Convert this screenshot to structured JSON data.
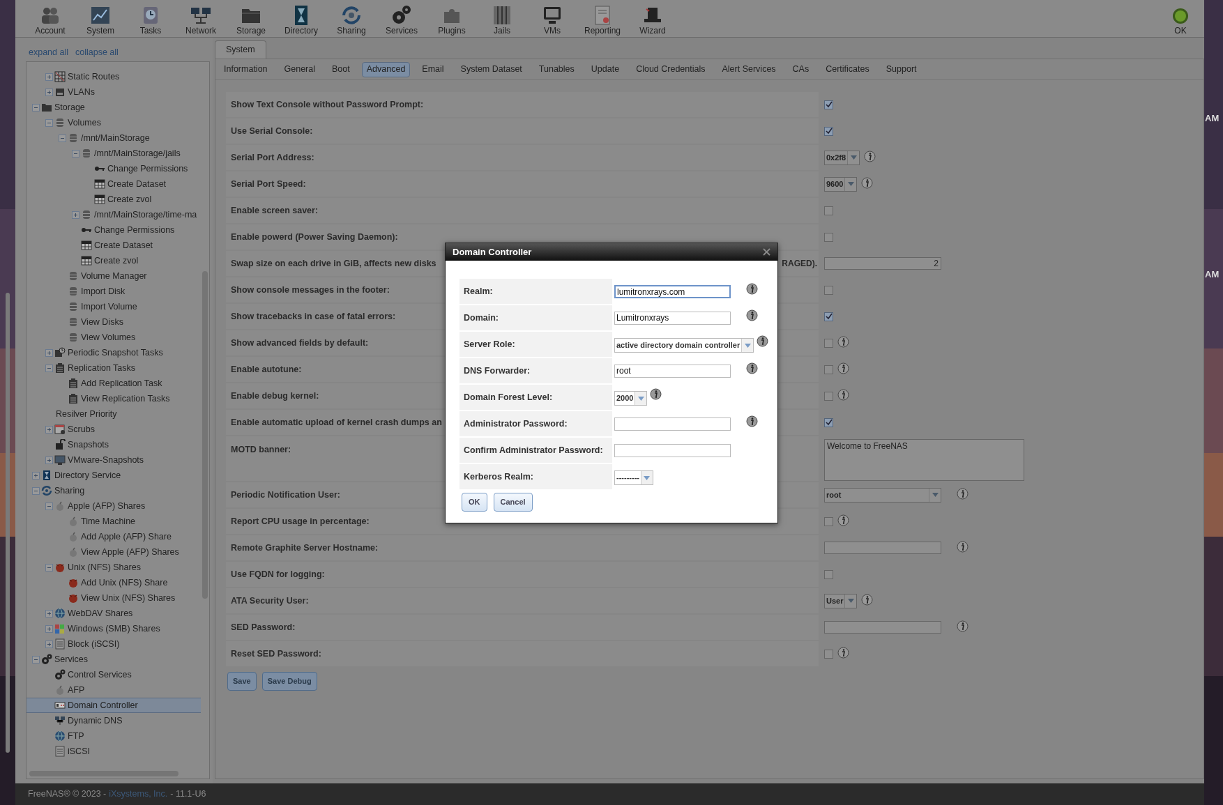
{
  "desktop": {
    "clock_fragments": [
      "AM",
      "AM"
    ]
  },
  "toolbar": {
    "items": [
      {
        "label": "Account"
      },
      {
        "label": "System"
      },
      {
        "label": "Tasks"
      },
      {
        "label": "Network"
      },
      {
        "label": "Storage"
      },
      {
        "label": "Directory"
      },
      {
        "label": "Sharing"
      },
      {
        "label": "Services"
      },
      {
        "label": "Plugins"
      },
      {
        "label": "Jails"
      },
      {
        "label": "VMs"
      },
      {
        "label": "Reporting"
      },
      {
        "label": "Wizard"
      }
    ],
    "alert": {
      "label": "OK"
    }
  },
  "sidebar": {
    "links": [
      "expand all",
      "collapse all"
    ],
    "tree": [
      {
        "children": [
          {
            "label": "Static Routes",
            "expanded": false,
            "selected": false
          },
          {
            "label": "VLANs",
            "expanded": false,
            "selected": false
          }
        ]
      },
      {
        "label": "Storage",
        "expanded": true,
        "selected": false,
        "children": [
          {
            "label": "Volumes",
            "expanded": true,
            "selected": false,
            "children": [
              {
                "label": "/mnt/MainStorage",
                "expanded": true,
                "selected": false,
                "children": [
                  {
                    "label": "/mnt/MainStorage/jails",
                    "expanded": true,
                    "selected": false,
                    "children": [
                      {
                        "label": "Change Permissions",
                        "selected": false
                      },
                      {
                        "label": "Create Dataset",
                        "selected": false
                      },
                      {
                        "label": "Create zvol",
                        "selected": false
                      }
                    ]
                  },
                  {
                    "label": "/mnt/MainStorage/time-ma",
                    "expanded": false,
                    "selected": false
                  },
                  {
                    "label": "Change Permissions",
                    "selected": false
                  },
                  {
                    "label": "Create Dataset",
                    "selected": false
                  },
                  {
                    "label": "Create zvol",
                    "selected": false
                  }
                ]
              },
              {
                "label": "Volume Manager",
                "selected": false
              },
              {
                "label": "Import Disk",
                "selected": false
              },
              {
                "label": "Import Volume",
                "selected": false
              },
              {
                "label": "View Disks",
                "selected": false
              },
              {
                "label": "View Volumes",
                "selected": false
              }
            ]
          },
          {
            "label": "Periodic Snapshot Tasks",
            "expanded": false,
            "selected": false
          },
          {
            "label": "Replication Tasks",
            "expanded": true,
            "selected": false,
            "children": [
              {
                "label": "Add Replication Task",
                "selected": false
              },
              {
                "label": "View Replication Tasks",
                "selected": false
              }
            ]
          },
          {
            "label": "Resilver Priority",
            "selected": false
          },
          {
            "label": "Scrubs",
            "expanded": false,
            "selected": false
          },
          {
            "label": "Snapshots",
            "selected": false
          },
          {
            "label": "VMware-Snapshots",
            "expanded": false,
            "selected": false
          }
        ]
      },
      {
        "label": "Directory Service",
        "expanded": false,
        "selected": false
      },
      {
        "label": "Sharing",
        "expanded": true,
        "selected": false,
        "children": [
          {
            "label": "Apple (AFP) Shares",
            "expanded": true,
            "selected": false,
            "children": [
              {
                "label": "Time Machine",
                "selected": false
              },
              {
                "label": "Add Apple (AFP) Share",
                "selected": false
              },
              {
                "label": "View Apple (AFP) Shares",
                "selected": false
              }
            ]
          },
          {
            "label": "Unix (NFS) Shares",
            "expanded": true,
            "selected": false,
            "children": [
              {
                "label": "Add Unix (NFS) Share",
                "selected": false
              },
              {
                "label": "View Unix (NFS) Shares",
                "selected": false
              }
            ]
          },
          {
            "label": "WebDAV Shares",
            "expanded": false,
            "selected": false
          },
          {
            "label": "Windows (SMB) Shares",
            "expanded": false,
            "selected": false
          },
          {
            "label": "Block (iSCSI)",
            "expanded": false,
            "selected": false
          }
        ]
      },
      {
        "label": "Services",
        "expanded": true,
        "selected": false,
        "children": [
          {
            "label": "Control Services",
            "selected": false
          },
          {
            "label": "AFP",
            "selected": false
          },
          {
            "label": "Domain Controller",
            "selected": true
          },
          {
            "label": "Dynamic DNS",
            "selected": false
          },
          {
            "label": "FTP",
            "selected": false
          },
          {
            "label": "iSCSI",
            "selected": false
          }
        ]
      }
    ]
  },
  "main": {
    "tabs": [
      {
        "label": "System",
        "selected": true
      }
    ],
    "subtabs": [
      {
        "label": "Information",
        "selected": false
      },
      {
        "label": "General",
        "selected": false
      },
      {
        "label": "Boot",
        "selected": false
      },
      {
        "label": "Advanced",
        "selected": true
      },
      {
        "label": "Email",
        "selected": false
      },
      {
        "label": "System Dataset",
        "selected": false
      },
      {
        "label": "Tunables",
        "selected": false
      },
      {
        "label": "Update",
        "selected": false
      },
      {
        "label": "Cloud Credentials",
        "selected": false
      },
      {
        "label": "Alert Services",
        "selected": false
      },
      {
        "label": "CAs",
        "selected": false
      },
      {
        "label": "Certificates",
        "selected": false
      },
      {
        "label": "Support",
        "selected": false
      }
    ],
    "settings": [
      {
        "label": "Show Text Console without Password Prompt:",
        "kind": "checkbox",
        "checked": true,
        "info": false
      },
      {
        "label": "Use Serial Console:",
        "kind": "checkbox",
        "checked": true,
        "info": false
      },
      {
        "label": "Serial Port Address:",
        "kind": "select",
        "value": "0x2f8",
        "wide": false,
        "info": true
      },
      {
        "label": "Serial Port Speed:",
        "kind": "select",
        "value": "9600",
        "wide": false,
        "info": true
      },
      {
        "label": "Enable screen saver:",
        "kind": "checkbox",
        "checked": false,
        "info": false
      },
      {
        "label": "Enable powerd (Power Saving Daemon):",
        "kind": "checkbox",
        "checked": false,
        "info": false
      },
      {
        "label": "Swap size on each drive in GiB, affects new disks",
        "label_end": "RAGED).",
        "kind": "input",
        "value": "2",
        "info": false
      },
      {
        "label": "Show console messages in the footer:",
        "kind": "checkbox",
        "checked": false,
        "info": false
      },
      {
        "label": "Show tracebacks in case of fatal errors:",
        "kind": "checkbox",
        "checked": true,
        "info": false
      },
      {
        "label": "Show advanced fields by default:",
        "kind": "checkbox",
        "checked": false,
        "info": true
      },
      {
        "label": "Enable autotune:",
        "kind": "checkbox",
        "checked": false,
        "info": true
      },
      {
        "label": "Enable debug kernel:",
        "kind": "checkbox",
        "checked": false,
        "info": true
      },
      {
        "label": "Enable automatic upload of kernel crash dumps an",
        "kind": "checkbox",
        "checked": true,
        "info": false
      },
      {
        "label": "MOTD banner:",
        "kind": "textarea",
        "value": "Welcome to FreeNAS",
        "info": false
      },
      {
        "label": "Periodic Notification User:",
        "kind": "select",
        "value": "root",
        "wide": true,
        "info": true
      },
      {
        "label": "Report CPU usage in percentage:",
        "kind": "checkbox",
        "checked": false,
        "info": true
      },
      {
        "label": "Remote Graphite Server Hostname:",
        "kind": "input",
        "info": true
      },
      {
        "label": "Use FQDN for logging:",
        "kind": "checkbox",
        "checked": false,
        "info": false
      },
      {
        "label": "ATA Security User:",
        "kind": "select",
        "value": "User",
        "wide": false,
        "info": true
      },
      {
        "label": "SED Password:",
        "kind": "input",
        "info": true
      },
      {
        "label": "Reset SED Password:",
        "kind": "checkbox",
        "checked": false,
        "info": true
      }
    ],
    "buttons": [
      "Save",
      "Save Debug"
    ]
  },
  "dialog": {
    "title": "Domain Controller",
    "fields": [
      {
        "label": "Realm:",
        "kind": "text",
        "value": "lumitronxrays.com",
        "focused": true,
        "info": true
      },
      {
        "label": "Domain:",
        "kind": "text",
        "value": "Lumitronxrays",
        "focused": false,
        "info": true
      },
      {
        "label": "Server Role:",
        "kind": "select",
        "value": "active directory domain controller",
        "focused": false,
        "info": true
      },
      {
        "label": "DNS Forwarder:",
        "kind": "text",
        "value": "root",
        "focused": false,
        "info": true
      },
      {
        "label": "Domain Forest Level:",
        "kind": "select",
        "value": "2000",
        "focused": false,
        "info": true
      },
      {
        "label": "Administrator Password:",
        "kind": "text",
        "focused": false,
        "info": true
      },
      {
        "label": "Confirm Administrator Password:",
        "kind": "text",
        "focused": false,
        "info": false
      },
      {
        "label": "Kerberos Realm:",
        "kind": "select",
        "value": "---------",
        "focused": false,
        "info": false
      }
    ],
    "buttons": [
      "OK",
      "Cancel"
    ]
  },
  "footer": {
    "prefix": "FreeNAS® © 2023 -",
    "link": "iXsystems, Inc.",
    "suffix": "- 11.1-U6"
  }
}
